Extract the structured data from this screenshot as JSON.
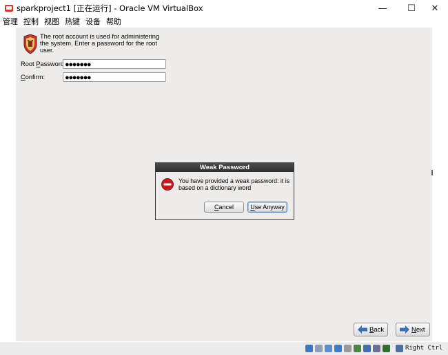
{
  "window": {
    "title": "sparkproject1 [正在运行] - Oracle VM VirtualBox",
    "controls": {
      "minimize": "—",
      "maximize": "☐",
      "close": "✕"
    }
  },
  "menubar": {
    "items": [
      "管理",
      "控制",
      "视图",
      "热键",
      "设备",
      "帮助"
    ]
  },
  "installer": {
    "intro_line1": "The root account is used for administering",
    "intro_line2": "the system.  Enter a password for the root",
    "intro_line3": "user.",
    "root_password_label_pre": "Root ",
    "root_password_label_mn": "P",
    "root_password_label_post": "assword:",
    "root_password_value": "●●●●●●●",
    "confirm_label_mn": "C",
    "confirm_label_post": "onfirm:",
    "confirm_value": "●●●●●●●"
  },
  "dialog": {
    "title": "Weak Password",
    "message_line1": "You have provided a weak password: it is",
    "message_line2": "based on a dictionary word",
    "cancel_mn": "C",
    "cancel_post": "ancel",
    "use_anyway_mn": "U",
    "use_anyway_post": "se Anyway"
  },
  "nav": {
    "back_mn": "B",
    "back_post": "ack",
    "next_mn": "N",
    "next_post": "ext"
  },
  "statusbar": {
    "host_key": "Right Ctrl"
  },
  "colors": {
    "guest_bg": "#edeceb",
    "dialog_title_bg": "#2e2e2e",
    "stop_icon": "#c8181d",
    "nav_arrow": "#3d6fb5"
  }
}
